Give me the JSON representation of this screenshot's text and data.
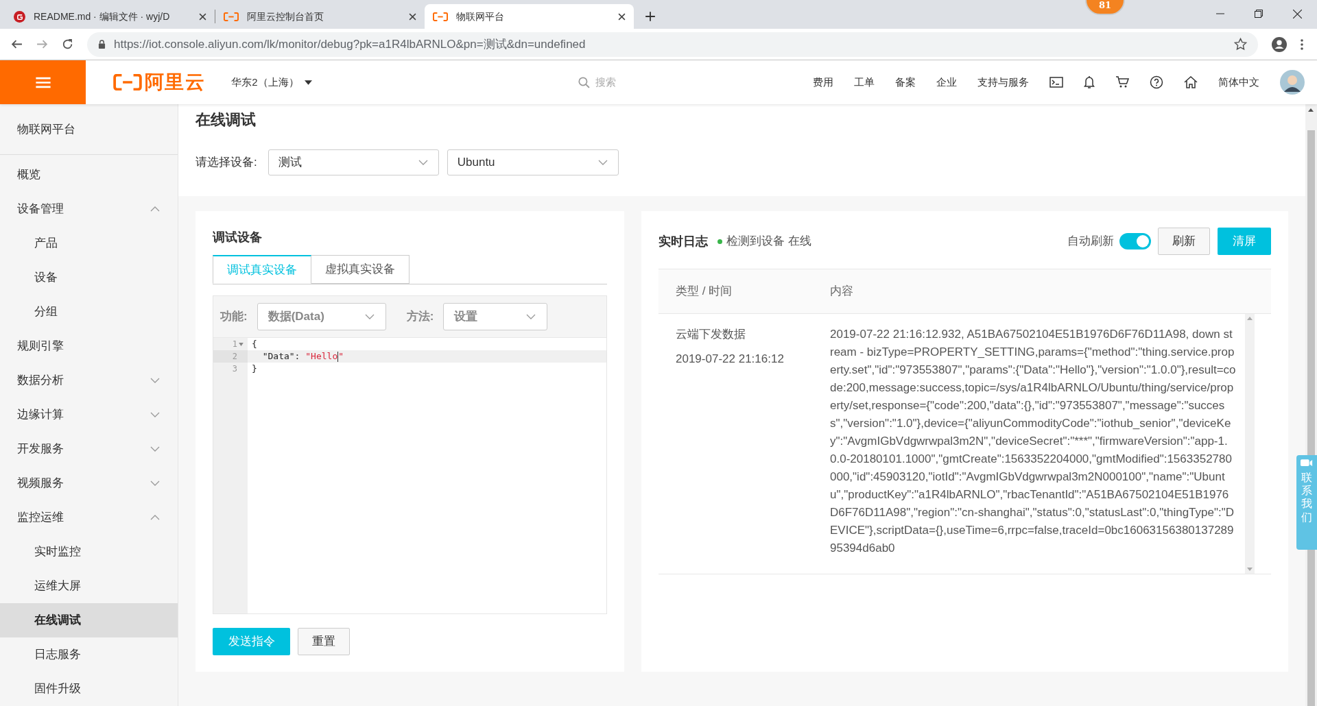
{
  "browser": {
    "tabs": [
      {
        "title": "README.md · 编辑文件 · wyj/D",
        "kind": "gitee",
        "selected": false
      },
      {
        "title": "阿里云控制台首页",
        "kind": "aliyun",
        "selected": false
      },
      {
        "title": "物联网平台",
        "kind": "aliyun",
        "selected": true
      }
    ],
    "url": "https://iot.console.aliyun.com/lk/monitor/debug?pk=a1R4lbARNLO&pn=测试&dn=undefined",
    "badge": "81"
  },
  "header": {
    "logo": "阿里云",
    "region": "华东2（上海）",
    "search": {
      "placeholder": "搜索"
    },
    "links": [
      "费用",
      "工单",
      "备案",
      "企业",
      "支持与服务"
    ],
    "language": "简体中文"
  },
  "sidebar": {
    "title": "物联网平台",
    "items": [
      {
        "label": "概览",
        "kind": "link",
        "selected": false
      },
      {
        "label": "设备管理",
        "kind": "group",
        "expanded": true,
        "children": [
          {
            "label": "产品",
            "selected": false
          },
          {
            "label": "设备",
            "selected": false
          },
          {
            "label": "分组",
            "selected": false
          }
        ]
      },
      {
        "label": "规则引擎",
        "kind": "link",
        "selected": false
      },
      {
        "label": "数据分析",
        "kind": "group",
        "expanded": false
      },
      {
        "label": "边缘计算",
        "kind": "group",
        "expanded": false
      },
      {
        "label": "开发服务",
        "kind": "group",
        "expanded": false
      },
      {
        "label": "视频服务",
        "kind": "group",
        "expanded": false
      },
      {
        "label": "监控运维",
        "kind": "group",
        "expanded": true,
        "children": [
          {
            "label": "实时监控",
            "selected": false
          },
          {
            "label": "运维大屏",
            "selected": false
          },
          {
            "label": "在线调试",
            "selected": true
          },
          {
            "label": "日志服务",
            "selected": false
          },
          {
            "label": "固件升级",
            "selected": false
          }
        ]
      }
    ]
  },
  "page": {
    "title": "在线调试",
    "device_label": "请选择设备:",
    "product": "测试",
    "device": "Ubuntu"
  },
  "debug": {
    "title": "调试设备",
    "tabs": [
      {
        "label": "调试真实设备",
        "selected": true
      },
      {
        "label": "虚拟真实设备",
        "selected": false
      }
    ],
    "function_label": "功能:",
    "function": "数据(Data)",
    "method_label": "方法:",
    "method": "设置",
    "editor": [
      {
        "number": "1",
        "foldable": true,
        "active": false,
        "tokens": [
          {
            "kind": "plain",
            "text": "{"
          }
        ]
      },
      {
        "number": "2",
        "foldable": false,
        "active": true,
        "tokens": [
          {
            "kind": "plain",
            "text": "  \"Data\": "
          },
          {
            "kind": "string",
            "text": "\"Hello"
          },
          {
            "kind": "cursor"
          },
          {
            "kind": "string",
            "text": "\""
          }
        ]
      },
      {
        "number": "3",
        "foldable": false,
        "active": false,
        "tokens": [
          {
            "kind": "plain",
            "text": "}"
          }
        ]
      }
    ],
    "send": "发送指令",
    "reset": "重置"
  },
  "log": {
    "title": "实时日志",
    "status": "检测到设备 在线",
    "online": true,
    "auto_refresh": {
      "label": "自动刷新",
      "on": true
    },
    "refresh": "刷新",
    "clear": "清屏",
    "columns": [
      "类型 / 时间",
      "内容"
    ],
    "rows": [
      {
        "type": "云端下发数据",
        "time": "2019-07-22 21:16:12",
        "content": "2019-07-22 21:16:12.932, A51BA67502104E51B1976D6F76D11A98, down stream - bizType=PROPERTY_SETTING,params={\"method\":\"thing.service.property.set\",\"id\":\"973553807\",\"params\":{\"Data\":\"Hello\"},\"version\":\"1.0.0\"},result=code:200,message:success,topic=/sys/a1R4lbARNLO/Ubuntu/thing/service/property/set,response={\"code\":200,\"data\":{},\"id\":\"973553807\",\"message\":\"success\",\"version\":\"1.0\"},device={\"aliyunCommodityCode\":\"iothub_senior\",\"deviceKey\":\"AvgmIGbVdgwrwpal3m2N\",\"deviceSecret\":\"***\",\"firmwareVersion\":\"app-1.0.0-20180101.1000\",\"gmtCreate\":1563352204000,\"gmtModified\":1563352780000,\"id\":45903120,\"iotId\":\"AvgmIGbVdgwrwpal3m2N000100\",\"name\":\"Ubuntu\",\"productKey\":\"a1R4lbARNLO\",\"rbacTenantId\":\"A51BA67502104E51B1976D6F76D11A98\",\"region\":\"cn-shanghai\",\"status\":0,\"statusLast\":0,\"thingType\":\"DEVICE\"},scriptData={},useTime=6,rrpc=false,traceId=0bc1606315638013728995394d6ab0"
      }
    ]
  },
  "contact": "联系我们"
}
